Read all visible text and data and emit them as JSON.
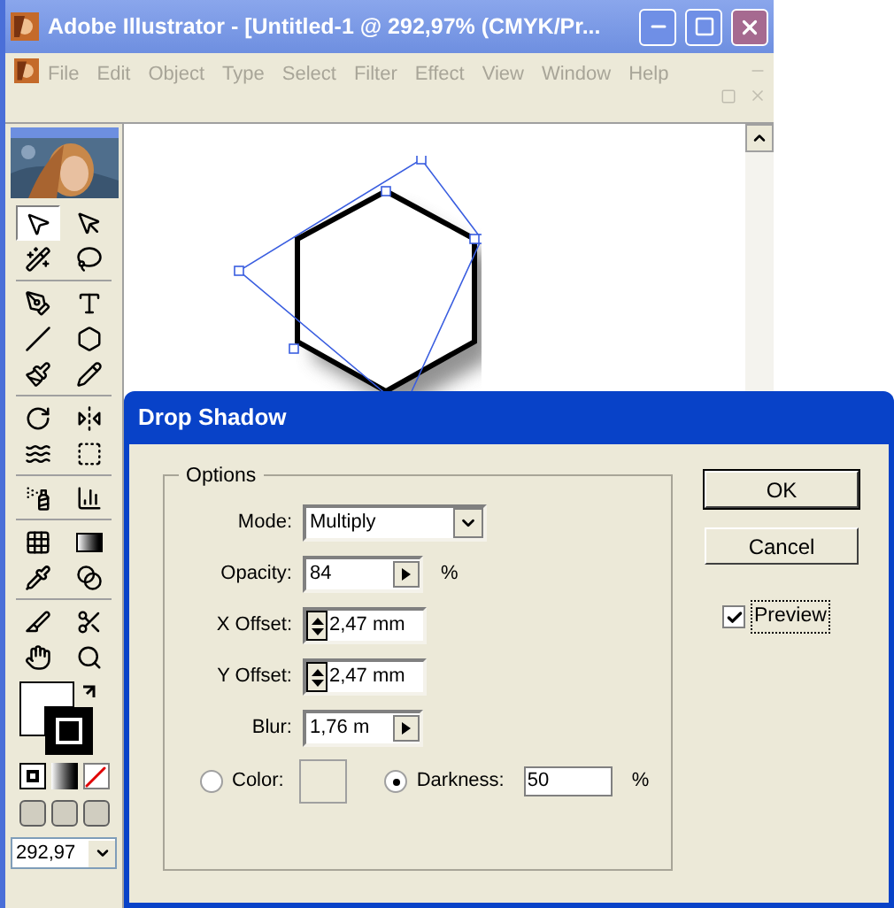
{
  "window": {
    "title": "Adobe Illustrator - [Untitled-1 @ 292,97% (CMYK/Pr..."
  },
  "menu": [
    "File",
    "Edit",
    "Object",
    "Type",
    "Select",
    "Filter",
    "Effect",
    "View",
    "Window",
    "Help"
  ],
  "tools": [
    {
      "kind": "arrow",
      "selected": true
    },
    {
      "kind": "direct",
      "selected": false
    },
    {
      "kind": "wand",
      "selected": false
    },
    {
      "kind": "lasso",
      "selected": false
    },
    {
      "kind": "pen",
      "selected": false
    },
    {
      "kind": "type",
      "selected": false
    },
    {
      "kind": "line",
      "selected": false
    },
    {
      "kind": "hexagon",
      "selected": false
    },
    {
      "kind": "brush",
      "selected": false
    },
    {
      "kind": "pencil",
      "selected": false
    },
    {
      "kind": "rotate",
      "selected": false
    },
    {
      "kind": "reflect",
      "selected": false
    },
    {
      "kind": "warp",
      "selected": false
    },
    {
      "kind": "transform",
      "selected": false
    },
    {
      "kind": "spray",
      "selected": false
    },
    {
      "kind": "graph",
      "selected": false
    },
    {
      "kind": "mesh",
      "selected": false
    },
    {
      "kind": "gradient",
      "selected": false
    },
    {
      "kind": "eyedropper",
      "selected": false
    },
    {
      "kind": "blend",
      "selected": false
    },
    {
      "kind": "knife",
      "selected": false
    },
    {
      "kind": "scissors",
      "selected": false
    },
    {
      "kind": "hand",
      "selected": false
    },
    {
      "kind": "zoom",
      "selected": false
    }
  ],
  "zoom_field": {
    "value": "292,97"
  },
  "dialog": {
    "title": "Drop Shadow",
    "group": "Options",
    "fields": [
      {
        "kind": "select",
        "label": "Mode:",
        "value": "Multiply"
      },
      {
        "kind": "popup",
        "label": "Opacity:",
        "value": "84",
        "unit": "%"
      },
      {
        "kind": "spinner",
        "label": "X Offset:",
        "value": "2,47 mm"
      },
      {
        "kind": "spinner",
        "label": "Y Offset:",
        "value": "2,47 mm"
      },
      {
        "kind": "popup",
        "label": "Blur:",
        "value": "1,76 m"
      }
    ],
    "color_option": {
      "label": "Color:",
      "selected": false
    },
    "darkness_option": {
      "label": "Darkness:",
      "selected": true,
      "value": "50",
      "unit": "%"
    },
    "buttons": [
      "OK",
      "Cancel"
    ],
    "preview": {
      "label": "Preview",
      "checked": true
    }
  }
}
